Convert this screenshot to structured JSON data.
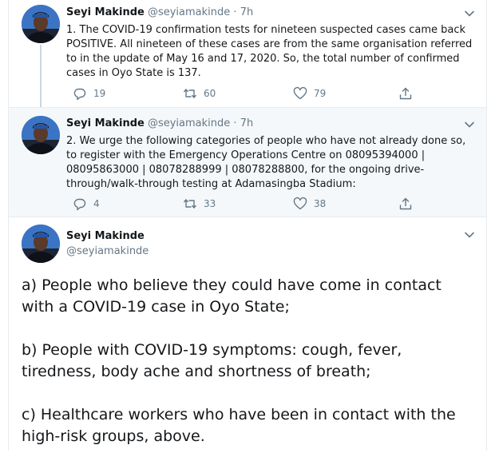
{
  "tweets": [
    {
      "name": "Seyi Makinde",
      "handle": "@seyiamakinde",
      "dot": "·",
      "time": "7h",
      "text": "1. The COVID-19 confirmation tests for nineteen suspected cases came back POSITIVE. All nineteen of these cases are from the same organisation referred to in the update of May 16 and 17, 2020. So, the total number of confirmed cases in Oyo State is 137.",
      "replies": "19",
      "retweets": "60",
      "likes": "79"
    },
    {
      "name": "Seyi Makinde",
      "handle": "@seyiamakinde",
      "dot": "·",
      "time": "7h",
      "text": "2. We urge the following categories of people who have not already done so, to register with the Emergency Operations Centre on 08095394000 | 08095863000 | 08078288999 | 08078288800, for the ongoing drive-through/walk-through testing at Adamasingba Stadium:",
      "replies": "4",
      "retweets": "33",
      "likes": "38"
    },
    {
      "name": "Seyi Makinde",
      "handle": "@seyiamakinde",
      "paragraphs": [
        "a) People who believe they could have come in contact with a COVID-19 case in Oyo State;",
        "b) People with COVID-19 symptoms: cough, fever, tiredness, body ache and shortness of breath;",
        "c) Healthcare workers who have been in contact with the high-risk groups, above."
      ]
    }
  ],
  "icons": {
    "reply": "reply-icon",
    "retweet": "retweet-icon",
    "like": "heart-icon",
    "share": "share-icon",
    "caret": "chevron-down-icon"
  },
  "colors": {
    "text": "#14171a",
    "muted": "#657786",
    "border": "#e6ecf0",
    "highlight_bg": "#f5f8fa",
    "thread_line": "#ccd6dd"
  }
}
